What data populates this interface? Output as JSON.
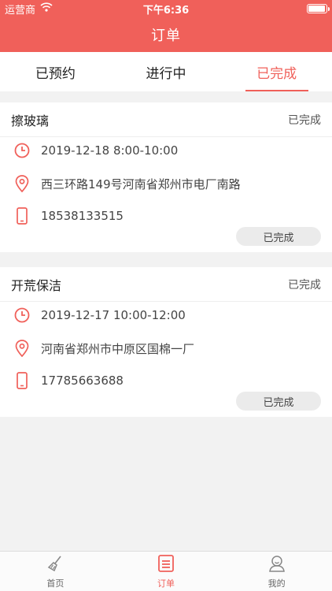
{
  "status_bar": {
    "carrier": "运营商",
    "time": "下午6:36",
    "battery_level": 0.95
  },
  "nav": {
    "title": "订单"
  },
  "tabs": [
    {
      "label": "已预约",
      "active": false
    },
    {
      "label": "进行中",
      "active": false
    },
    {
      "label": "已完成",
      "active": true
    }
  ],
  "orders": [
    {
      "title": "擦玻璃",
      "status": "已完成",
      "time": "2019-12-18 8:00-10:00",
      "address": "西三环路149号河南省郑州市电厂南路",
      "phone": "18538133515",
      "button": "已完成"
    },
    {
      "title": "开荒保洁",
      "status": "已完成",
      "time": "2019-12-17 10:00-12:00",
      "address": "河南省郑州市中原区国棉一厂",
      "phone": "17785663688",
      "button": "已完成"
    }
  ],
  "tabbar": [
    {
      "label": "首页",
      "icon": "broom-icon"
    },
    {
      "label": "订单",
      "icon": "order-list-icon"
    },
    {
      "label": "我的",
      "icon": "profile-icon"
    }
  ],
  "colors": {
    "accent": "#f0605a",
    "background": "#f2f2f2"
  }
}
